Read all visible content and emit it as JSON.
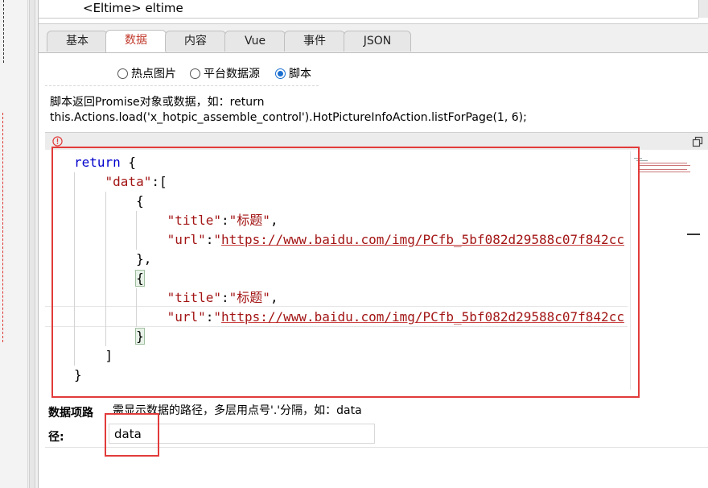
{
  "top_row": {
    "text": "<Eltime> eltime"
  },
  "tabs": [
    {
      "label": "基本",
      "active": false
    },
    {
      "label": "数据",
      "active": true
    },
    {
      "label": "内容",
      "active": false
    },
    {
      "label": "Vue",
      "active": false
    },
    {
      "label": "事件",
      "active": false
    },
    {
      "label": "JSON",
      "active": false
    }
  ],
  "source_options": [
    {
      "label": "热点图片",
      "checked": false
    },
    {
      "label": "平台数据源",
      "checked": false
    },
    {
      "label": "脚本",
      "checked": true
    }
  ],
  "script_hint": {
    "line1": "脚本返回Promise对象或数据，如：return",
    "line2": "this.Actions.load('x_hotpic_assemble_control').HotPictureInfoAction.listForPage(1, 6);"
  },
  "code": {
    "return_kw": "return",
    "open_brace": " {",
    "data_key": "\"data\"",
    "data_sep": ":[",
    "items": [
      {
        "open": "{",
        "title_key": "\"title\"",
        "title_val": "\"标题\"",
        "url_key": "\"url\"",
        "url_quote": "\"",
        "url_val": "https://www.baidu.com/img/PCfb_5bf082d29588c07f842cc",
        "close": "},"
      },
      {
        "open": "{",
        "title_key": "\"title\"",
        "title_val": "\"标题\"",
        "url_key": "\"url\"",
        "url_quote": "\"",
        "url_val": "https://www.baidu.com/img/PCfb_5bf082d29588c07f842cc",
        "close": "}"
      }
    ],
    "close_bracket": "]",
    "close_brace": "}"
  },
  "data_path": {
    "label": "数据项路径:",
    "hint": "需显示数据的路径，多层用点号'.'分隔，如：data",
    "value": "data"
  },
  "colors": {
    "highlight_frame": "#e23b3b",
    "active_tab_text": "#c0392b",
    "keyword": "#0000cc",
    "string": "#a31515"
  },
  "icons": {
    "info": "info-circle-icon",
    "maximize": "window-restore-icon",
    "radio": "radio-button-icon"
  }
}
